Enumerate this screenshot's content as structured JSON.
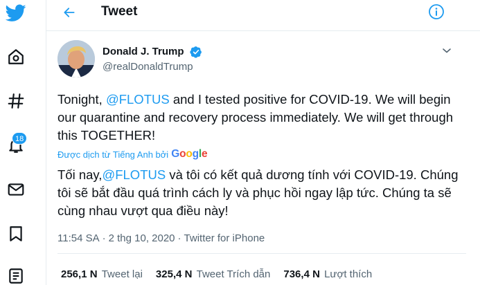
{
  "header": {
    "title": "Tweet"
  },
  "sidebar": {
    "notification_count": "18"
  },
  "author": {
    "name": "Donald J. Trump",
    "handle": "@realDonaldTrump"
  },
  "tweet": {
    "text_before_mention": "Tonight, ",
    "mention": "@FLOTUS",
    "text_after_mention": " and I tested positive for COVID-19. We will begin our quarantine and recovery process immediately. We will get through this TOGETHER!",
    "translation_label": "Được dịch từ Tiếng Anh bởi",
    "translation_provider": "Google",
    "translated_before_mention": "Tối nay,",
    "translated_mention": "@FLOTUS",
    "translated_after_mention": " và tôi có kết quả dương tính với COVID-19. Chúng tôi sẽ bắt đầu quá trình cách ly và phục hồi ngay lập tức. Chúng ta sẽ cùng nhau vượt qua điều này!",
    "time": "11:54 SA",
    "separator": "·",
    "date": "2 thg 10, 2020",
    "source": "Twitter for iPhone"
  },
  "stats": {
    "retweets_count": "256,1 N",
    "retweets_label": "Tweet lại",
    "quotes_count": "325,4 N",
    "quotes_label": "Tweet Trích dẫn",
    "likes_count": "736,4 N",
    "likes_label": "Lượt thích"
  },
  "colors": {
    "accent": "#1d9bf0",
    "text": "#0f1419",
    "secondary": "#536471",
    "divider": "#e6ecf0"
  }
}
